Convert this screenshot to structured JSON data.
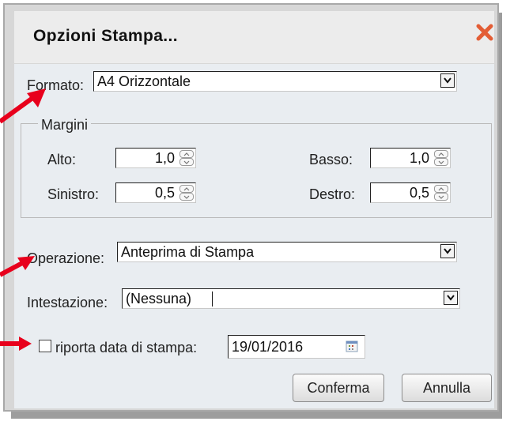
{
  "dialog": {
    "title": "Opzioni Stampa...",
    "close_icon": "close-icon"
  },
  "formato": {
    "label": "Formato:",
    "value": "A4 Orizzontale"
  },
  "margini": {
    "legend": "Margini",
    "alto_label": "Alto:",
    "alto_value": "1,0",
    "basso_label": "Basso:",
    "basso_value": "1,0",
    "sinistro_label": "Sinistro:",
    "sinistro_value": "0,5",
    "destro_label": "Destro:",
    "destro_value": "0,5"
  },
  "operazione": {
    "label": "Operazione:",
    "value": "Anteprima di Stampa"
  },
  "intestazione": {
    "label": "Intestazione:",
    "value": "(Nessuna)"
  },
  "data_stampa": {
    "label": "riporta data di stampa:",
    "value": "19/01/2016",
    "checked": false
  },
  "buttons": {
    "confirm": "Conferma",
    "cancel": "Annulla"
  },
  "colors": {
    "arrow": "#e8001c",
    "close": "#e35d35"
  }
}
